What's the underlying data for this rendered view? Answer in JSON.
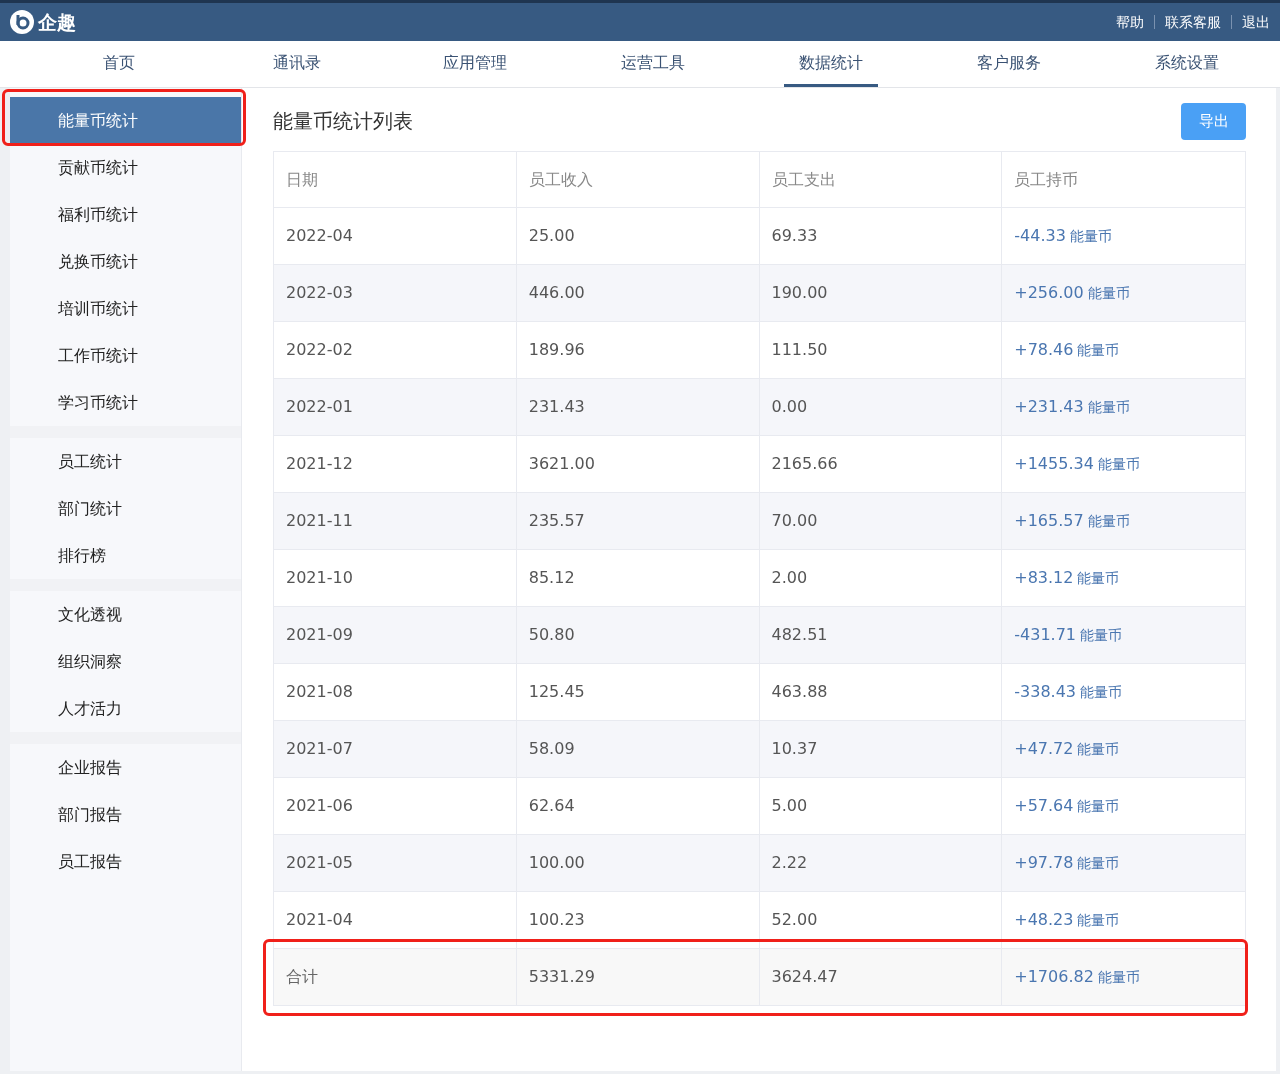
{
  "header": {
    "brand": "企趣",
    "links": [
      "帮助",
      "联系客服",
      "退出"
    ]
  },
  "nav": [
    {
      "label": "首页",
      "selected": false
    },
    {
      "label": "通讯录",
      "selected": false
    },
    {
      "label": "应用管理",
      "selected": false
    },
    {
      "label": "运营工具",
      "selected": false
    },
    {
      "label": "数据统计",
      "selected": true
    },
    {
      "label": "客户服务",
      "selected": false
    },
    {
      "label": "系统设置",
      "selected": false
    }
  ],
  "sidebar": {
    "groups": [
      {
        "items": [
          {
            "label": "能量币统计",
            "selected": true,
            "highlighted": true
          },
          {
            "label": "贡献币统计",
            "selected": false,
            "highlighted": false
          },
          {
            "label": "福利币统计",
            "selected": false,
            "highlighted": false
          },
          {
            "label": "兑换币统计",
            "selected": false,
            "highlighted": false
          },
          {
            "label": "培训币统计",
            "selected": false,
            "highlighted": false
          },
          {
            "label": "工作币统计",
            "selected": false,
            "highlighted": false
          },
          {
            "label": "学习币统计",
            "selected": false,
            "highlighted": false
          }
        ]
      },
      {
        "items": [
          {
            "label": "员工统计",
            "selected": false,
            "highlighted": false
          },
          {
            "label": "部门统计",
            "selected": false,
            "highlighted": false
          },
          {
            "label": "排行榜",
            "selected": false,
            "highlighted": false
          }
        ]
      },
      {
        "items": [
          {
            "label": "文化透视",
            "selected": false,
            "highlighted": false
          },
          {
            "label": "组织洞察",
            "selected": false,
            "highlighted": false
          },
          {
            "label": "人才活力",
            "selected": false,
            "highlighted": false
          }
        ]
      },
      {
        "items": [
          {
            "label": "企业报告",
            "selected": false,
            "highlighted": false
          },
          {
            "label": "部门报告",
            "selected": false,
            "highlighted": false
          },
          {
            "label": "员工报告",
            "selected": false,
            "highlighted": false
          }
        ]
      }
    ]
  },
  "page": {
    "title": "能量币统计列表",
    "export_button": "导出"
  },
  "table": {
    "columns": [
      "日期",
      "员工收入",
      "员工支出",
      "员工持币"
    ],
    "rows": [
      {
        "cells": [
          "2022-04",
          "25.00",
          "69.33"
        ],
        "balance": "-44.33",
        "unit": "能量币"
      },
      {
        "cells": [
          "2022-03",
          "446.00",
          "190.00"
        ],
        "balance": "+256.00",
        "unit": "能量币"
      },
      {
        "cells": [
          "2022-02",
          "189.96",
          "111.50"
        ],
        "balance": "+78.46",
        "unit": "能量币"
      },
      {
        "cells": [
          "2022-01",
          "231.43",
          "0.00"
        ],
        "balance": "+231.43",
        "unit": "能量币"
      },
      {
        "cells": [
          "2021-12",
          "3621.00",
          "2165.66"
        ],
        "balance": "+1455.34",
        "unit": "能量币"
      },
      {
        "cells": [
          "2021-11",
          "235.57",
          "70.00"
        ],
        "balance": "+165.57",
        "unit": "能量币"
      },
      {
        "cells": [
          "2021-10",
          "85.12",
          "2.00"
        ],
        "balance": "+83.12",
        "unit": "能量币"
      },
      {
        "cells": [
          "2021-09",
          "50.80",
          "482.51"
        ],
        "balance": "-431.71",
        "unit": "能量币"
      },
      {
        "cells": [
          "2021-08",
          "125.45",
          "463.88"
        ],
        "balance": "-338.43",
        "unit": "能量币"
      },
      {
        "cells": [
          "2021-07",
          "58.09",
          "10.37"
        ],
        "balance": "+47.72",
        "unit": "能量币"
      },
      {
        "cells": [
          "2021-06",
          "62.64",
          "5.00"
        ],
        "balance": "+57.64",
        "unit": "能量币"
      },
      {
        "cells": [
          "2021-05",
          "100.00",
          "2.22"
        ],
        "balance": "+97.78",
        "unit": "能量币"
      },
      {
        "cells": [
          "2021-04",
          "100.23",
          "52.00"
        ],
        "balance": "+48.23",
        "unit": "能量币"
      }
    ],
    "total": {
      "cells": [
        "合计",
        "5331.29",
        "3624.47"
      ],
      "balance": "+1706.82",
      "unit": "能量币",
      "highlighted": true
    }
  }
}
